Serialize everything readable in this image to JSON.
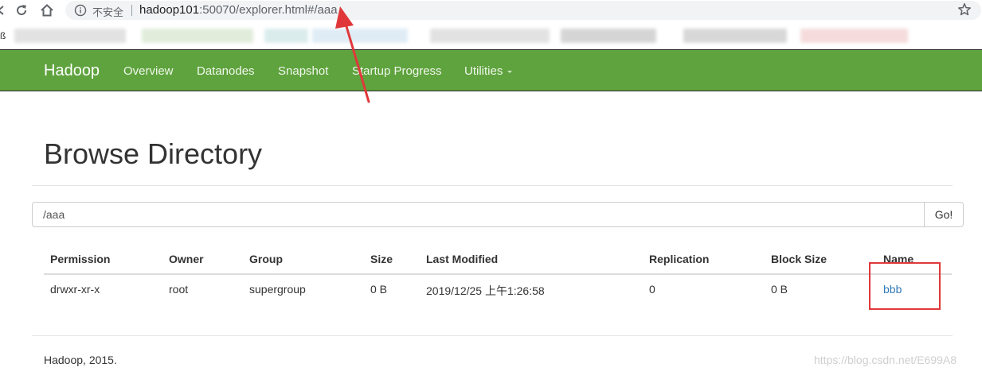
{
  "browser": {
    "security_label": "不安全",
    "url_host": "hadoop101",
    "url_rest": ":50070/explorer.html#/aaa",
    "bookmarks_edge_char": "ß"
  },
  "navbar": {
    "brand": "Hadoop",
    "items": [
      {
        "label": "Overview"
      },
      {
        "label": "Datanodes"
      },
      {
        "label": "Snapshot"
      },
      {
        "label": "Startup Progress"
      },
      {
        "label": "Utilities"
      }
    ],
    "background": "#5fa33e"
  },
  "page": {
    "title": "Browse Directory",
    "path_value": "/aaa",
    "go_label": "Go!"
  },
  "table": {
    "columns": [
      "Permission",
      "Owner",
      "Group",
      "Size",
      "Last Modified",
      "Replication",
      "Block Size",
      "Name"
    ],
    "rows": [
      {
        "permission": "drwxr-xr-x",
        "owner": "root",
        "group": "supergroup",
        "size": "0 B",
        "last_modified": "2019/12/25 上午1:26:58",
        "replication": "0",
        "block_size": "0 B",
        "name": "bbb"
      }
    ]
  },
  "footer": {
    "text": "Hadoop, 2015.",
    "watermark": "https://blog.csdn.net/E699A8"
  },
  "colors": {
    "link": "#337ab7",
    "annotation_red": "#e0383a"
  },
  "icons": [
    "back-arrow-icon",
    "reload-icon",
    "home-icon",
    "info-icon",
    "star-icon"
  ]
}
